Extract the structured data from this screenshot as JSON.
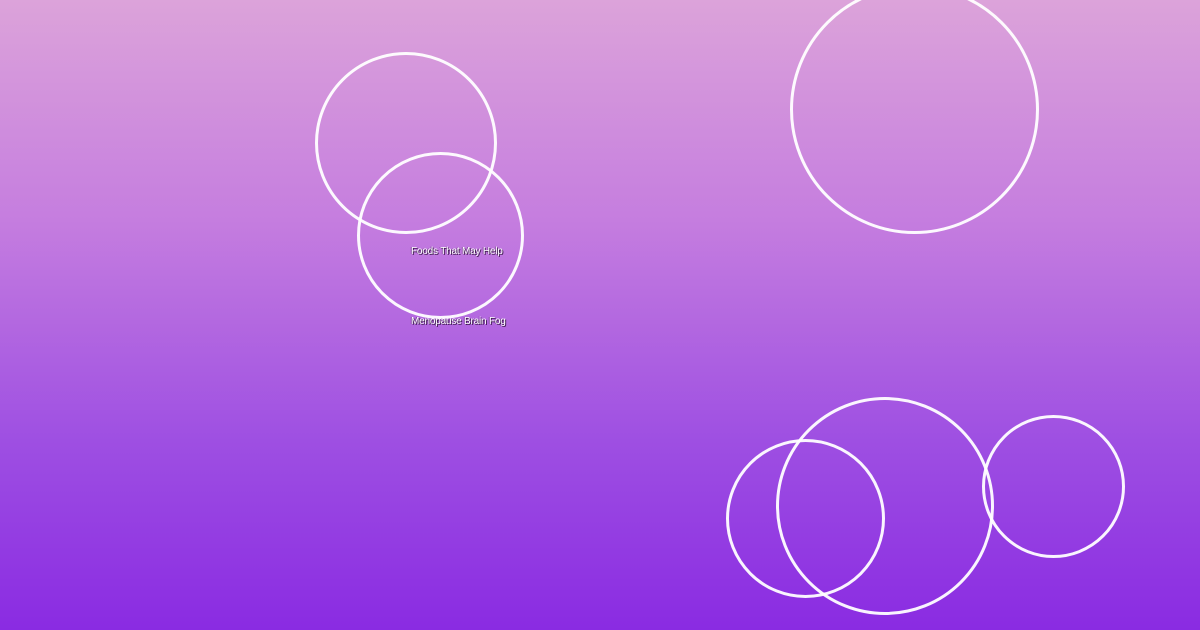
{
  "background": {
    "gradient_top": "#dca3da",
    "gradient_bottom": "#8a2be2",
    "ring_color": "#ffffff"
  },
  "text": {
    "line1": "Foods That May Help",
    "line2": "Menopause Brain Fog"
  }
}
